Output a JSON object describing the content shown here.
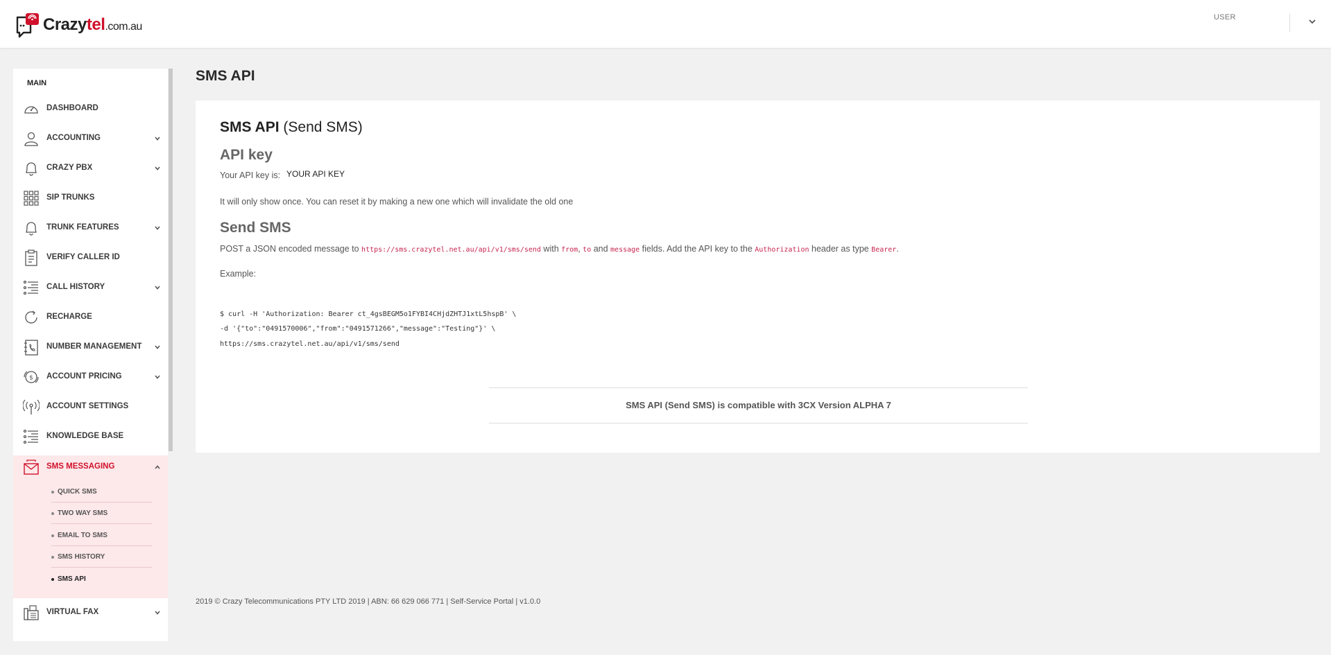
{
  "header": {
    "logo_main": "Crazy",
    "logo_accent": "tel",
    "logo_domain": ".com.au",
    "user_label": "USER"
  },
  "sidebar": {
    "section": "MAIN",
    "items": [
      {
        "label": "DASHBOARD",
        "icon": "speedometer-icon",
        "has_chevron": false
      },
      {
        "label": "ACCOUNTING",
        "icon": "user-icon",
        "has_chevron": true
      },
      {
        "label": "CRAZY PBX",
        "icon": "bell-icon",
        "has_chevron": true
      },
      {
        "label": "SIP TRUNKS",
        "icon": "grid-icon",
        "has_chevron": false
      },
      {
        "label": "TRUNK FEATURES",
        "icon": "bell-icon",
        "has_chevron": true
      },
      {
        "label": "VERIFY CALLER ID",
        "icon": "clipboard-icon",
        "has_chevron": false
      },
      {
        "label": "CALL HISTORY",
        "icon": "list-icon",
        "has_chevron": true
      },
      {
        "label": "RECHARGE",
        "icon": "refresh-icon",
        "has_chevron": false
      },
      {
        "label": "NUMBER MANAGEMENT",
        "icon": "phonebook-icon",
        "has_chevron": true
      },
      {
        "label": "ACCOUNT PRICING",
        "icon": "dollar-icon",
        "has_chevron": true
      },
      {
        "label": "ACCOUNT SETTINGS",
        "icon": "antenna-icon",
        "has_chevron": false
      },
      {
        "label": "KNOWLEDGE BASE",
        "icon": "list-icon",
        "has_chevron": false
      },
      {
        "label": "SMS MESSAGING",
        "icon": "envelope-icon",
        "has_chevron": true,
        "active": true
      },
      {
        "label": "VIRTUAL FAX",
        "icon": "fax-icon",
        "has_chevron": true
      }
    ],
    "sms_subitems": [
      "QUICK SMS",
      "TWO WAY SMS",
      "EMAIL TO SMS",
      "SMS HISTORY",
      "SMS API"
    ],
    "current_subitem": "SMS API"
  },
  "main": {
    "page_title": "SMS API",
    "card_title_bold": "SMS API",
    "card_title_rest": " (Send SMS)",
    "api_key_heading": "API key",
    "api_key_label": "Your API key is:",
    "api_key_value": "YOUR API KEY",
    "api_key_note": "It will only show once. You can reset it by making a new one which will invalidate the old one",
    "send_heading": "Send SMS",
    "send_text_1": "POST a JSON encoded message to ",
    "send_url": "https://sms.crazytel.net.au/api/v1/sms/send",
    "send_text_2": " with ",
    "field_from": "from",
    "send_text_3": ", ",
    "field_to": "to",
    "send_text_4": " and ",
    "field_message": "message",
    "send_text_5": " fields. Add the API key to the ",
    "header_auth": "Authorization",
    "send_text_6": " header as type ",
    "type_bearer": "Bearer",
    "send_text_7": ".",
    "example_label": "Example:",
    "code_line_1": "$ curl -H 'Authorization: Bearer ct_4gsBEGM5o1FYBI4CHjdZHTJ1xtL5hspB' \\",
    "code_line_2": "-d '{\"to\":\"0491570006\",\"from\":\"0491571266\",\"message\":\"Testing\"}' \\",
    "code_line_3": "https://sms.crazytel.net.au/api/v1/sms/send",
    "compat_text": "SMS API (Send SMS) is compatible with 3CX Version ALPHA 7"
  },
  "footer": {
    "text": "2019 © Crazy Telecommunications PTY LTD 2019 | ABN: 66 629 066 771 | Self-Service Portal | v1.0.0"
  },
  "colors": {
    "brand_red": "#d0112b",
    "active_bg": "#fde8ea",
    "code_pink": "#c7254e"
  }
}
